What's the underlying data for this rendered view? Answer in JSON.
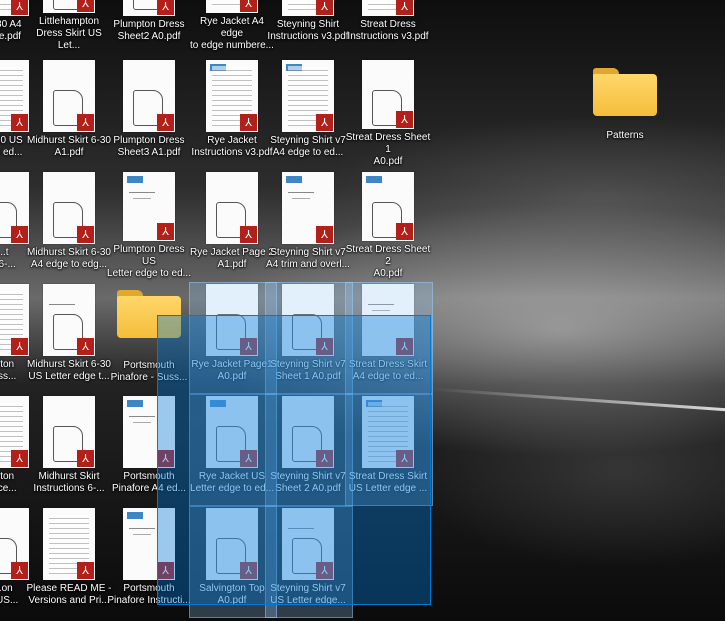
{
  "desktop": {
    "pattern_folder": {
      "label": "Patterns",
      "icon": "folder-icon"
    },
    "drag_folder": {
      "label": "Portsmouth\nPinafore - Suss..."
    },
    "pdf_files": [
      {
        "label": "...-30 A4\n...ge.pdf"
      },
      {
        "label": "Littlehampton\nDress Skirt US Let..."
      },
      {
        "label": "Plumpton Dress\nSheet2 A0.pdf"
      },
      {
        "label": "Rye Jacket A4 edge\nto edge numbere..."
      },
      {
        "label": "Steyning Shirt\nInstructions v3.pdf"
      },
      {
        "label": "Streat Dress\nInstructions v3.pdf"
      },
      {
        "label": "...-30 US\n...to ed..."
      },
      {
        "label": "Midhurst Skirt 6-30\nA1.pdf"
      },
      {
        "label": "Plumpton Dress\nSheet3 A1.pdf"
      },
      {
        "label": "Rye Jacket\nInstructions v3.pdf"
      },
      {
        "label": "Steyning Shirt v7\nA4 edge to ed..."
      },
      {
        "label": "Streat Dress Sheet 1\nA0.pdf"
      },
      {
        "label": "...t\n...6-..."
      },
      {
        "label": "Midhurst Skirt 6-30\nA4 edge to edg..."
      },
      {
        "label": "Plumpton Dress US\nLetter edge to ed..."
      },
      {
        "label": "Rye Jacket Page 2\nA1.pdf"
      },
      {
        "label": "Steyning Shirt v7\nA4 trim and overl..."
      },
      {
        "label": "Streat Dress Sheet 2\nA0.pdf"
      },
      {
        "label": "...ton\n...ss..."
      },
      {
        "label": "Midhurst Skirt 6-30\nUS Letter edge t..."
      },
      {
        "label": "Rye Jacket Page1\nA0.pdf"
      },
      {
        "label": "Steyning Shirt v7\nSheet 1 A0.pdf"
      },
      {
        "label": "Streat Dress Skirt\nA4 edge to ed..."
      },
      {
        "label": "...ton\n...ce..."
      },
      {
        "label": "Midhurst Skirt\nInstructions 6-..."
      },
      {
        "label": "Portsmouth\nPinafore A4 ed..."
      },
      {
        "label": "Rye Jacket US\nLetter edge to ed..."
      },
      {
        "label": "Steyning Shirt v7\nSheet 2 A0.pdf"
      },
      {
        "label": "Streat Dress Skirt\nUS Letter edge ..."
      },
      {
        "label": "...on\n...US..."
      },
      {
        "label": "Please READ ME -\nVersions and Pri..."
      },
      {
        "label": "Portsmouth\nPinafore Instructi..."
      },
      {
        "label": "Salvington Top\nA0.pdf"
      },
      {
        "label": "Steyning Shirt v7\nUS Letter edge..."
      }
    ],
    "colors": {
      "selection": "#0078d7",
      "pdf_badge": "#b3201a",
      "folder": "#f5bd3c"
    }
  }
}
